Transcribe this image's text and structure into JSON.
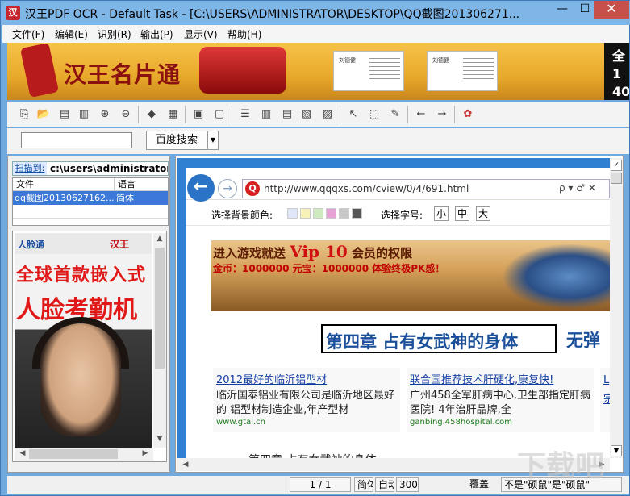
{
  "window": {
    "title": "汉王PDF OCR - Default Task - [C:\\USERS\\ADMINISTRATOR\\DESKTOP\\QQ截图201306271...",
    "app_icon": "汉",
    "min_label": "—",
    "max_label": "☐",
    "close_label": "✕"
  },
  "menu": [
    "文件(F)",
    "编辑(E)",
    "识别(R)",
    "输出(P)",
    "显示(V)",
    "帮助(H)"
  ],
  "banner": {
    "logo_text": "汉王名片通",
    "right_text": "全1 40",
    "card_name": "刘德健"
  },
  "toolbar": {
    "icons": [
      "open-icon",
      "folder-icon",
      "scan-icon",
      "scan-page-icon",
      "zoom-in-icon",
      "zoom-out-icon",
      "erase-icon",
      "image-icon",
      "layout-icon",
      "layout-alt-icon",
      "column-icon",
      "grid-icon",
      "table-icon",
      "table-delete-icon",
      "select-tool-icon",
      "edit-area-icon",
      "pen-icon",
      "arrow-left-icon",
      "arrow-right-icon",
      "color-icon"
    ]
  },
  "search": {
    "value": "",
    "button_label": "百度搜索",
    "dropdown_arrow": "▼"
  },
  "left": {
    "path_label": "扫描到:",
    "path_value": "c:\\users\\administrator",
    "col_file": "文件",
    "col_lang": "语言",
    "file_name": "qq截图20130627162...",
    "file_lang": "简体",
    "thumb_brand1": "人脸通",
    "thumb_brand2": "汉王",
    "thumb_line1": "全球首款嵌入式",
    "thumb_line2": "人脸考勤机"
  },
  "browser": {
    "back": "←",
    "forward": "→",
    "q_icon": "Q",
    "url": "http://www.qqqxs.com/cview/0/4/691.html",
    "url_tools": "ρ ▾ ♂ ✕"
  },
  "options": {
    "bg_label": "选择背景颜色:",
    "check": "✓",
    "swatches": [
      "#dfe6f7",
      "#f7f3b8",
      "#cfe9c0",
      "#e7a3d6",
      "#c8c8c8",
      "#555555"
    ],
    "size_label": "选择字号:",
    "sizes": [
      "小",
      "中",
      "大"
    ]
  },
  "ad": {
    "title_pre": "进入游戏就送",
    "title_vip": "Vip 10",
    "title_post": "会员的权限",
    "subtitle": "金币：1000000 元宝：1000000 体验终极PK感！"
  },
  "chapter": {
    "title": "第四章  占有女武神的身体",
    "next": "无弹"
  },
  "ads": [
    {
      "title": "2012最好的临沂铝型材",
      "desc": "临沂国泰铝业有限公司是临沂地区最好的 铝型材制造企业,年产型材",
      "url": "www.gtal.cn"
    },
    {
      "title": "联合国推荐技术肝硬化,康复快!",
      "desc": "广州458全军肝病中心,卫生部指定肝病医院! 4年治肝品牌,全",
      "url": "ganbing.458hospital.com"
    }
  ],
  "ad_edge": "L 宗",
  "footer_text": "第四章  占有女武神的身体",
  "status": {
    "page": "1 / 1",
    "lang": "简体",
    "auto": "自动",
    "dpi": "300",
    "mode": "覆盖",
    "tip": "不是\"硕鼠\"是\"硕鼠\""
  },
  "watermark": "下载吧"
}
